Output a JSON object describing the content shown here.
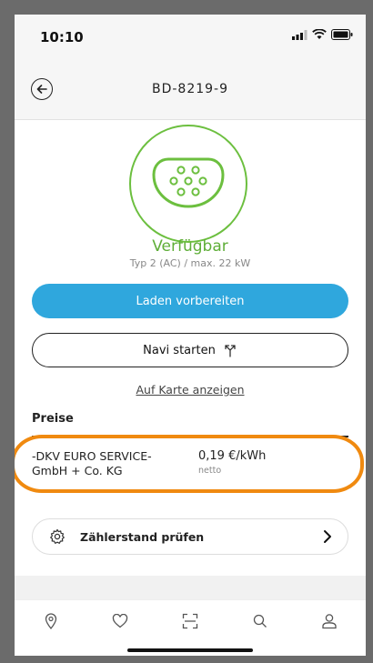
{
  "status_bar": {
    "time": "10:10"
  },
  "header": {
    "title": "BD-8219-9"
  },
  "station": {
    "status": "Verfügbar",
    "connector_info": "Typ 2 (AC) / max. 22 kW",
    "status_color": "#6cbf3f"
  },
  "actions": {
    "prepare_charging_label": "Laden vorbereiten",
    "navigate_label": "Navi starten",
    "show_on_map_label": "Auf Karte anzeigen"
  },
  "prices": {
    "section_title": "Preise",
    "provider_line1": "-DKV EURO SERVICE-",
    "provider_line2": "GmbH + Co. KG",
    "price": "0,19 €/kWh",
    "price_note": "netto",
    "highlight_color": "#f08a10"
  },
  "meter": {
    "label": "Zählerstand prüfen"
  },
  "tab_bar": {
    "items": [
      "map-pin-icon",
      "heart-icon",
      "scan-icon",
      "search-icon",
      "user-icon"
    ]
  },
  "colors": {
    "accent": "#2fa7dd"
  }
}
